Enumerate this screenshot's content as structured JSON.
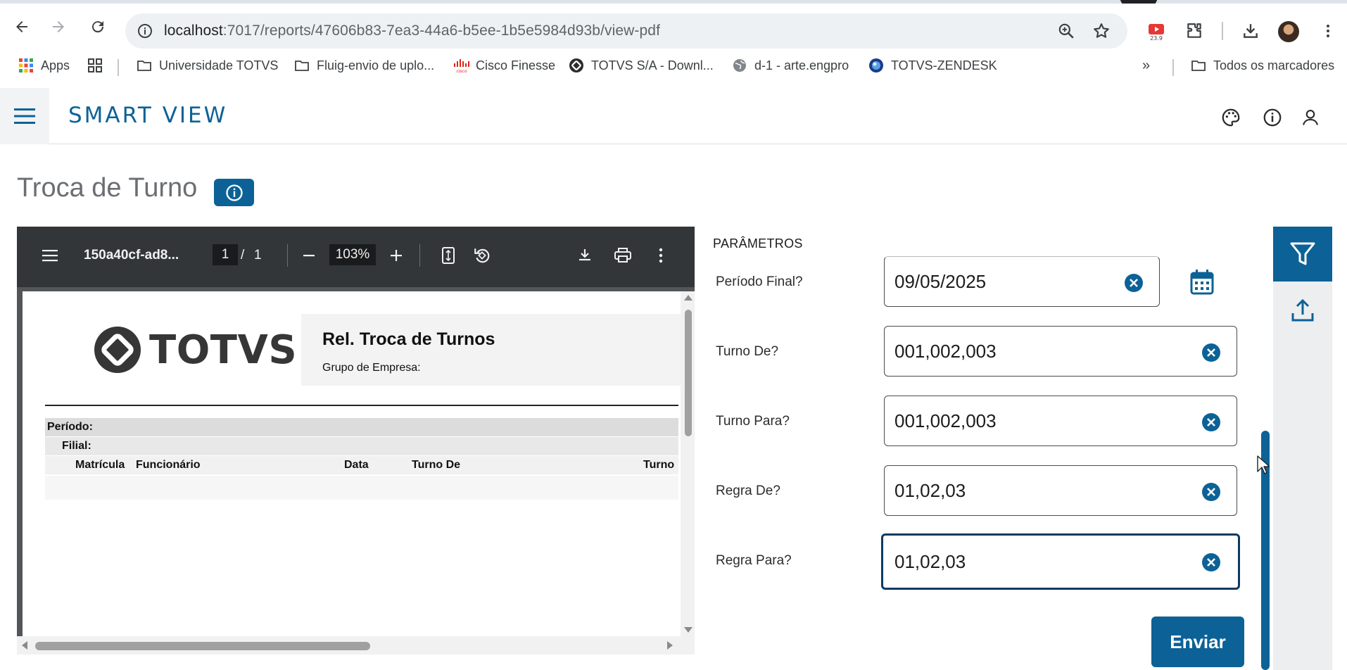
{
  "browser": {
    "url_host": "localhost",
    "url_rest": ":7017/reports/47606b83-7ea3-44a6-b5ee-1b5e5984d93b/view-pdf",
    "extension_badge": "23.9"
  },
  "bookmarks": {
    "items": [
      {
        "label": "Apps"
      },
      {
        "label": ""
      },
      {
        "label": "Universidade TOTVS"
      },
      {
        "label": "Fluig-envio de uplo..."
      },
      {
        "label": "Cisco Finesse"
      },
      {
        "label": "TOTVS S/A - Downl..."
      },
      {
        "label": "d-1 - arte.engpro"
      },
      {
        "label": "TOTVS-ZENDESK"
      }
    ],
    "more": "»",
    "all_bookmarks": "Todos os marcadores"
  },
  "app": {
    "brand": "SMART VIEW",
    "page_title": "Troca de Turno"
  },
  "pdf": {
    "file_name": "150a40cf-ad8...",
    "page_current": "1",
    "page_separator": "/",
    "page_total": "1",
    "zoom": "103%",
    "logo_text": "TOTVS",
    "report_title": "Rel. Troca de Turnos",
    "report_subtitle": "Grupo de Empresa:",
    "row_periodo": "Período:",
    "row_filial": "Filial:",
    "columns": [
      "Matrícula",
      "Funcionário",
      "Data",
      "Turno De",
      "Turno"
    ]
  },
  "parameters": {
    "title": "PARÂMETROS",
    "fields": [
      {
        "label": "Período Final?",
        "value": "09/05/2025"
      },
      {
        "label": "Turno De?",
        "value": "001,002,003"
      },
      {
        "label": "Turno Para?",
        "value": "001,002,003"
      },
      {
        "label": "Regra De?",
        "value": "01,02,03"
      },
      {
        "label": "Regra Para?",
        "value": "01,02,03"
      }
    ],
    "submit": "Enviar"
  },
  "colors": {
    "primary": "#0c6296",
    "pdf_toolbar": "#323639",
    "focus_border": "#0b3a63"
  }
}
